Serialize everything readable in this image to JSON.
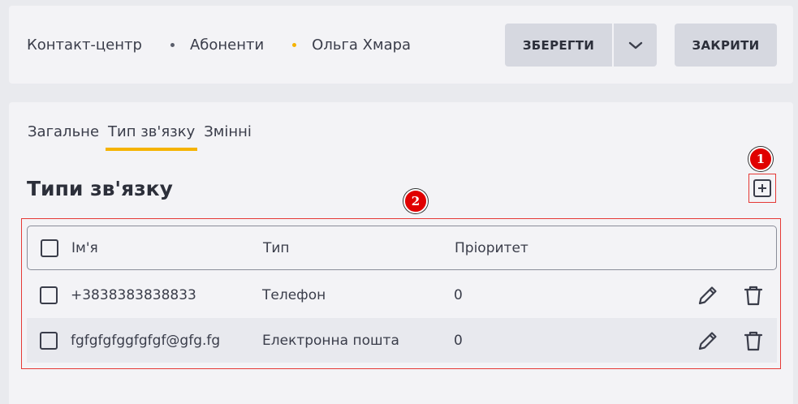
{
  "breadcrumb": {
    "items": [
      "Контакт-центр",
      "Абоненти",
      "Ольга Хмара"
    ]
  },
  "toolbar": {
    "save_label": "ЗБЕРЕГТИ",
    "close_label": "ЗАКРИТИ"
  },
  "tabs": [
    {
      "label": "Загальне",
      "active": false
    },
    {
      "label": "Тип зв'язку",
      "active": true
    },
    {
      "label": "Змінні",
      "active": false
    }
  ],
  "section": {
    "title": "Типи зв'язку"
  },
  "markers": [
    "1",
    "2"
  ],
  "table": {
    "headers": [
      "Ім'я",
      "Тип",
      "Пріоритет"
    ],
    "rows": [
      {
        "name": "+3838383838833",
        "type": "Телефон",
        "priority": "0"
      },
      {
        "name": "fgfgfgfggfgfgf@gfg.fg",
        "type": "Електронна пошта",
        "priority": "0"
      }
    ]
  },
  "colors": {
    "accent": "#f5b300",
    "annotation": "#e53935",
    "marker": "#e00000"
  }
}
